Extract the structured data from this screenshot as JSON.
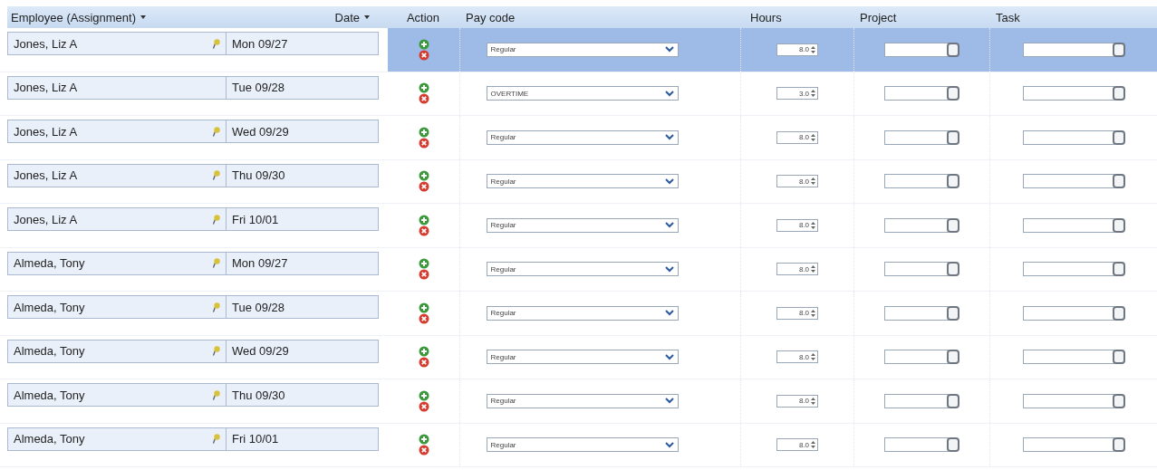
{
  "columns": [
    {
      "label": "Employee (Assignment)",
      "sortable": true
    },
    {
      "label": "Date",
      "sortable": true
    },
    {
      "label": "Action",
      "sortable": false
    },
    {
      "label": "Pay code",
      "sortable": false
    },
    {
      "label": "Hours",
      "sortable": false
    },
    {
      "label": "Project",
      "sortable": false
    },
    {
      "label": "Task",
      "sortable": false
    }
  ],
  "rows": [
    {
      "employee": "Jones, Liz A",
      "has_note": true,
      "date": "Mon 09/27",
      "pay_code": "Regular",
      "hours": "8.0",
      "selected": true
    },
    {
      "employee": "Jones, Liz A",
      "has_note": false,
      "date": "Tue 09/28",
      "pay_code": "OVERTIME",
      "hours": "3.0",
      "selected": false
    },
    {
      "employee": "Jones, Liz A",
      "has_note": true,
      "date": "Wed 09/29",
      "pay_code": "Regular",
      "hours": "8.0",
      "selected": false
    },
    {
      "employee": "Jones, Liz A",
      "has_note": true,
      "date": "Thu 09/30",
      "pay_code": "Regular",
      "hours": "8.0",
      "selected": false
    },
    {
      "employee": "Jones, Liz A",
      "has_note": true,
      "date": "Fri 10/01",
      "pay_code": "Regular",
      "hours": "8.0",
      "selected": false
    },
    {
      "employee": "Almeda, Tony",
      "has_note": true,
      "date": "Mon 09/27",
      "pay_code": "Regular",
      "hours": "8.0",
      "selected": false
    },
    {
      "employee": "Almeda, Tony",
      "has_note": true,
      "date": "Tue 09/28",
      "pay_code": "Regular",
      "hours": "8.0",
      "selected": false
    },
    {
      "employee": "Almeda, Tony",
      "has_note": true,
      "date": "Wed 09/29",
      "pay_code": "Regular",
      "hours": "8.0",
      "selected": false
    },
    {
      "employee": "Almeda, Tony",
      "has_note": true,
      "date": "Thu 09/30",
      "pay_code": "Regular",
      "hours": "8.0",
      "selected": false
    },
    {
      "employee": "Almeda, Tony",
      "has_note": true,
      "date": "Fri 10/01",
      "pay_code": "Regular",
      "hours": "8.0",
      "selected": false
    }
  ]
}
